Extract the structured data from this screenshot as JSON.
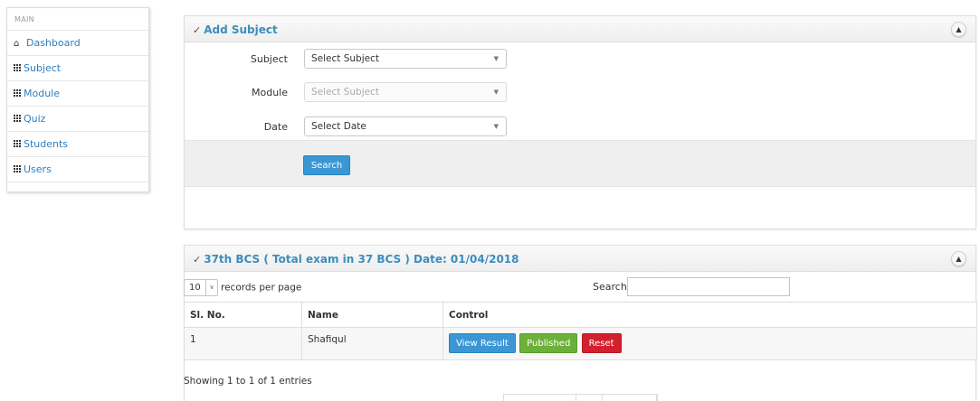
{
  "sidebar": {
    "section_label": "MAIN",
    "items": [
      {
        "label": "Dashboard",
        "icon": "home-icon"
      },
      {
        "label": "Subject",
        "icon": "grid-icon"
      },
      {
        "label": "Module",
        "icon": "grid-icon"
      },
      {
        "label": "Quiz",
        "icon": "grid-icon"
      },
      {
        "label": "Students",
        "icon": "grid-icon"
      },
      {
        "label": "Users",
        "icon": "grid-icon"
      }
    ]
  },
  "add_subject": {
    "title": "Add Subject",
    "fields": {
      "subject": {
        "label": "Subject",
        "value": "Select Subject"
      },
      "module": {
        "label": "Module",
        "value": "Select Subject"
      },
      "date": {
        "label": "Date",
        "value": "Select Date"
      }
    },
    "search_button": "Search"
  },
  "results": {
    "title": "37th BCS ( Total exam in 37 BCS ) Date: 01/04/2018",
    "records_per_page_value": "10",
    "records_per_page_label": "records per page",
    "search_label": "Search:",
    "columns": [
      "Sl. No.",
      "Name",
      "Control"
    ],
    "rows": [
      {
        "sl": "1",
        "name": "Shafiqul"
      }
    ],
    "actions": {
      "view": "View Result",
      "published": "Published",
      "reset": "Reset"
    },
    "info": "Showing 1 to 1 of 1 entries"
  },
  "colors": {
    "link": "#2d7fc0",
    "primary": "#3a97d4",
    "success": "#6bb039",
    "danger": "#d3202d"
  }
}
